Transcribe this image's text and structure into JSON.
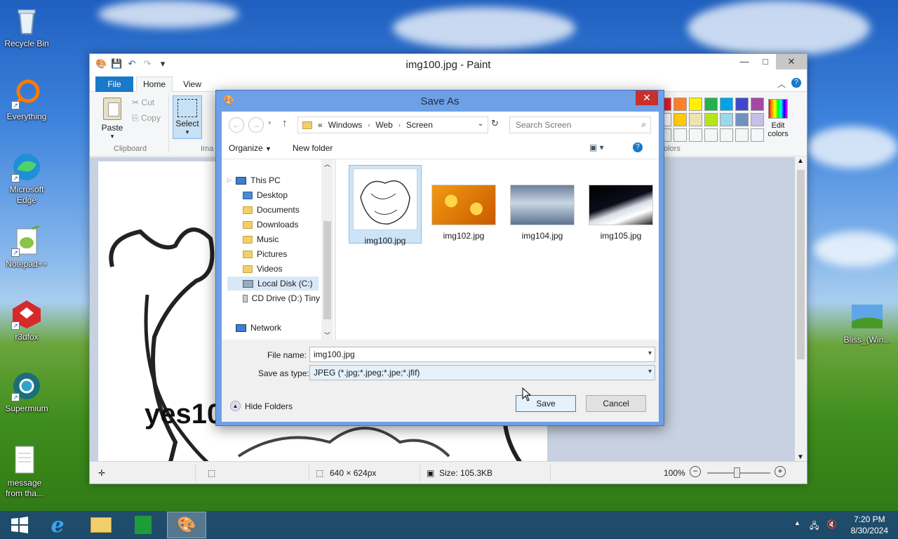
{
  "desktop": {
    "icons": [
      {
        "label": "Recycle Bin"
      },
      {
        "label": "Everything"
      },
      {
        "label": "Microsoft Edge"
      },
      {
        "label": "Notepad++"
      },
      {
        "label": "r3dfox"
      },
      {
        "label": "Supermium"
      },
      {
        "label": "message from tha..."
      },
      {
        "label": "Bliss_(Win..."
      }
    ]
  },
  "paint": {
    "title": "img100.jpg - Paint",
    "tabs": {
      "file": "File",
      "home": "Home",
      "view": "View"
    },
    "ribbon": {
      "paste": "Paste",
      "cut": "Cut",
      "copy": "Copy",
      "clipboard_group": "Clipboard",
      "select": "Select",
      "image_group": "Ima",
      "colors_group": "olors",
      "edit_colors": "Edit colors"
    },
    "palette": [
      "#c8002b",
      "#ff7f27",
      "#fff200",
      "#22b14c",
      "#00a2e8",
      "#3f48cc",
      "#a349a4",
      "#ffffff",
      "#ffc90e",
      "#efe4b0",
      "#b5e61d",
      "#99d9ea",
      "#7092be",
      "#c8bfe7",
      "#ffffff",
      "#ffffff",
      "#ffffff",
      "#ffffff",
      "#ffffff",
      "#ffffff",
      "#ffffff"
    ],
    "canvas_text": "yes10",
    "status": {
      "dimensions": "640 × 624px",
      "size": "Size: 105.3KB",
      "zoom": "100%"
    }
  },
  "dialog": {
    "title": "Save As",
    "breadcrumb": [
      "«",
      "Windows",
      "Web",
      "Screen"
    ],
    "search_placeholder": "Search Screen",
    "organize": "Organize",
    "new_folder": "New folder",
    "tree": [
      {
        "label": "This PC"
      },
      {
        "label": "Desktop"
      },
      {
        "label": "Documents"
      },
      {
        "label": "Downloads"
      },
      {
        "label": "Music"
      },
      {
        "label": "Pictures"
      },
      {
        "label": "Videos"
      },
      {
        "label": "Local Disk (C:)"
      },
      {
        "label": "CD Drive (D:) Tiny"
      },
      {
        "label": "Network"
      }
    ],
    "files": [
      {
        "name": "img100.jpg"
      },
      {
        "name": "img102.jpg"
      },
      {
        "name": "img104.jpg"
      },
      {
        "name": "img105.jpg"
      }
    ],
    "file_name_label": "File name:",
    "file_name_value": "img100.jpg",
    "save_type_label": "Save as type:",
    "save_type_value": "JPEG (*.jpg;*.jpeg;*.jpe;*.jfif)",
    "hide_folders": "Hide Folders",
    "save": "Save",
    "cancel": "Cancel"
  },
  "taskbar": {
    "time": "7:20 PM",
    "date": "8/30/2024"
  }
}
